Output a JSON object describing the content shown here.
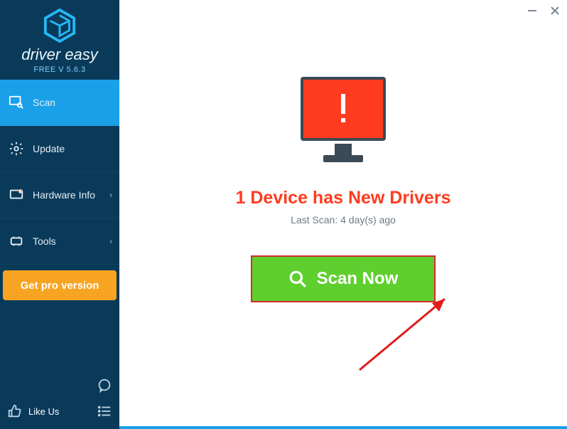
{
  "brand": {
    "name": "driver easy",
    "version": "FREE V 5.6.3"
  },
  "sidebar": {
    "items": [
      {
        "label": "Scan"
      },
      {
        "label": "Update"
      },
      {
        "label": "Hardware Info"
      },
      {
        "label": "Tools"
      }
    ],
    "pro_label": "Get pro version",
    "like_label": "Like Us"
  },
  "main": {
    "headline": "1 Device has New Drivers",
    "last_scan": "Last Scan: 4 day(s) ago",
    "scan_label": "Scan Now"
  }
}
